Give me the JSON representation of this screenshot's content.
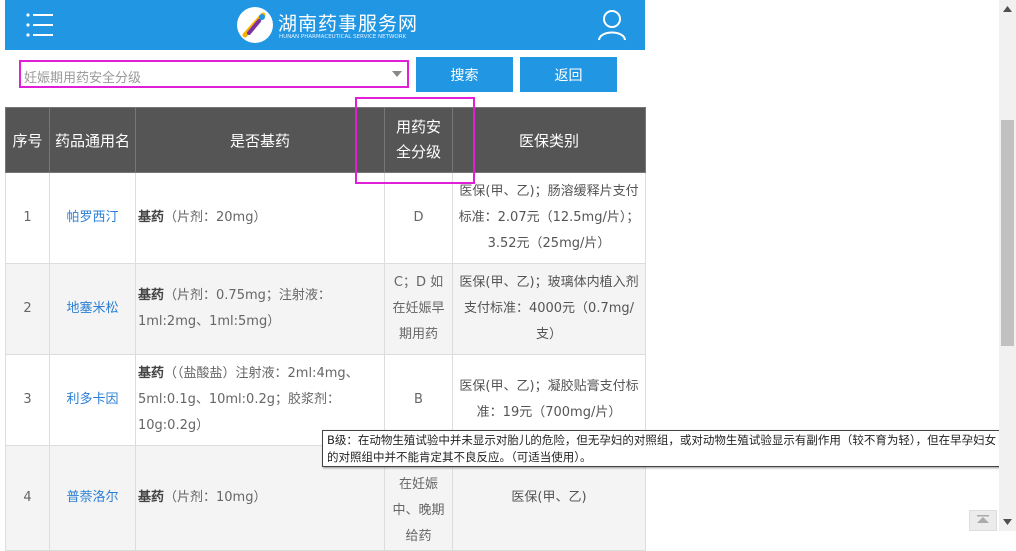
{
  "header": {
    "menu_icon": "menu-icon",
    "logo_title": "湖南药事服务网",
    "logo_subtitle": "HUNAN PHARMACEUTICAL SERVICE NETWORK",
    "user_icon": "user-icon",
    "color": "#2196e3"
  },
  "search": {
    "selected_value": "妊娠期用药安全分级",
    "search_label": "搜索",
    "back_label": "返回"
  },
  "table": {
    "headers": [
      "序号",
      "药品通用名",
      "是否基药",
      "用药安全分级",
      "医保类别"
    ],
    "rows": [
      {
        "index": "1",
        "name": "帕罗西汀",
        "essential_tag": "基药",
        "essential_detail": "（片剂：20mg）",
        "safety_grade": "D",
        "insurance": "医保(甲、乙)；肠溶缓释片支付标准：2.07元（12.5mg/片）；3.52元（25mg/片）"
      },
      {
        "index": "2",
        "name": "地塞米松",
        "essential_tag": "基药",
        "essential_detail": "（片剂：0.75mg；注射液：1ml:2mg、1ml:5mg）",
        "safety_grade": "C；D 如在妊娠早期用药",
        "insurance": "医保(甲、乙)；玻璃体内植入剂支付标准：4000元（0.7mg/支）"
      },
      {
        "index": "3",
        "name": "利多卡因",
        "essential_tag": "基药",
        "essential_detail": "（（盐酸盐）注射液：2ml:4mg、5ml:0.1g、10ml:0.2g；胶浆剂：10g:0.2g）",
        "safety_grade": "B",
        "insurance": "医保(甲、乙)；凝胶贴膏支付标准：19元（700mg/片）"
      },
      {
        "index": "4",
        "name": "普萘洛尔",
        "essential_tag": "基药",
        "essential_detail": "（片剂：10mg）",
        "safety_grade": "C；D 如在妊娠中、晚期给药",
        "insurance": "医保(甲、乙)"
      }
    ]
  },
  "tooltip": {
    "text": "B级：在动物生殖试验中并未显示对胎儿的危险，但无孕妇的对照组，或对动物生殖试验显示有副作用（较不育为轻），但在早孕妇女的对照组中并不能肯定其不良反应。（可适当使用）。"
  },
  "colors": {
    "highlight": "#e020d6",
    "table_header": "#555555",
    "link": "#2a7fd4"
  }
}
